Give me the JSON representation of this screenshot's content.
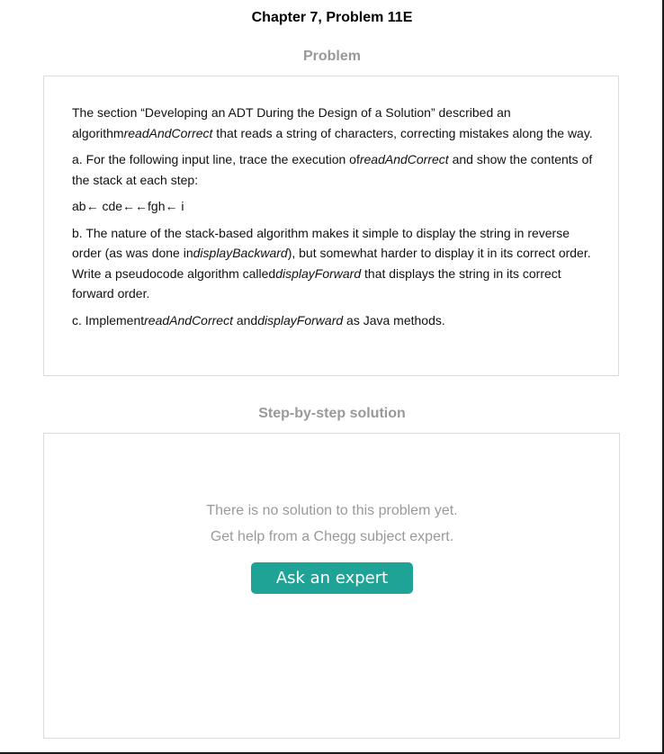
{
  "header": {
    "chapter_title": "Chapter 7, Problem 11E"
  },
  "problem": {
    "heading": "Problem",
    "paragraph1": {
      "text_a": "The section “Developing an ADT During the Design of a Solution” described an algorithm",
      "em_a": "readAndCorrect",
      "text_b": " that reads a string of characters, correcting mistakes along the way."
    },
    "paragraph2": {
      "text_a": "a. For the following input line, trace the execution of",
      "em_a": "readAndCorrect",
      "text_b": " and show the contents of the stack at each step:"
    },
    "input_line": "ab← cde←←fgh← i",
    "paragraph3": {
      "text_a": "b. The nature of the stack-based algorithm makes it simple to display the string in reverse order (as was done in",
      "em_a": "displayBackward",
      "text_b": "), but somewhat harder to display it in its correct order. Write a pseudocode algorithm called",
      "em_b": "displayForward",
      "text_c": " that displays the string in its correct forward order."
    },
    "paragraph4": {
      "text_a": "c. Implement",
      "em_a": "readAndCorrect",
      "text_b": " and",
      "em_b": "displayForward",
      "text_c": " as Java methods."
    }
  },
  "solution": {
    "heading": "Step-by-step solution",
    "no_solution_text": "There is no solution to this problem yet.",
    "get_help_text": "Get help from a Chegg subject expert.",
    "ask_button_label": "Ask an expert",
    "accent_color": "#1fa397"
  }
}
